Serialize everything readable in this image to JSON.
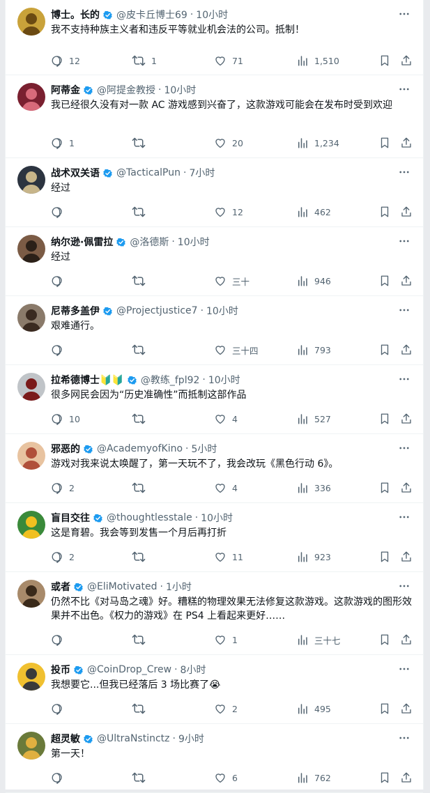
{
  "colors": {
    "verified": "#1d9bf0",
    "muted": "#536471",
    "text": "#0f1419"
  },
  "icons": {
    "reply": "reply-icon",
    "retweet": "retweet-icon",
    "like": "like-icon",
    "views": "views-icon",
    "bookmark": "bookmark-icon",
    "share": "share-icon",
    "more": "more-icon",
    "verified": "verified-badge-icon"
  },
  "tweets": [
    {
      "name": "博士。长的",
      "handle": "@皮卡丘博士69",
      "time": "10小时",
      "text": "我不支持种族主义者和违反平等就业机会法的公司。抵制！",
      "replies": "12",
      "retweets": "1",
      "likes": "71",
      "views": "1,510"
    },
    {
      "name": "阿蒂金",
      "handle": "@阿提金教授",
      "time": "10小时",
      "text": "我已经很久没有对一款 AC 游戏感到兴奋了，这款游戏可能会在发布时受到欢迎",
      "replies": "1",
      "retweets": "",
      "likes": "20",
      "views": "1,234"
    },
    {
      "name": "战术双关语",
      "handle": "@TacticalPun",
      "time": "7小时",
      "text": "经过",
      "replies": "",
      "retweets": "",
      "likes": "12",
      "views": "462"
    },
    {
      "name": "纳尔逊·佩雷拉",
      "handle": "@洛德斯",
      "time": "10小时",
      "text": "经过",
      "replies": "",
      "retweets": "",
      "likes": "三十",
      "views": "946"
    },
    {
      "name": "尼蒂多盖伊",
      "handle": "@Projectjustice7",
      "time": "10小时",
      "text": "艰难通行。",
      "replies": "",
      "retweets": "",
      "likes": "三十四",
      "views": "793"
    },
    {
      "name": "拉希德博士🔰🔰",
      "handle": "@教练_fpl92",
      "time": "10小时",
      "text": "很多网民会因为“历史准确性”而抵制这部作品",
      "replies": "10",
      "retweets": "",
      "likes": "4",
      "views": "527"
    },
    {
      "name": "邪恶的",
      "handle": "@AcademyofKino",
      "time": "5小时",
      "text": "游戏对我来说太唤醒了，第一天玩不了，我会改玩《黑色行动 6》。",
      "replies": "2",
      "retweets": "",
      "likes": "4",
      "views": "336"
    },
    {
      "name": "盲目交往",
      "handle": "@thoughtlesstale",
      "time": "10小时",
      "text": "这是育碧。我会等到发售一个月后再打折",
      "replies": "2",
      "retweets": "",
      "likes": "11",
      "views": "923"
    },
    {
      "name": "或者",
      "handle": "@EliMotivated",
      "time": "1小时",
      "text": "仍然不比《对马岛之魂》好。糟糕的物理效果无法修复这款游戏。这款游戏的图形效果并不出色。《权力的游戏》在 PS4 上看起来更好……",
      "replies": "",
      "retweets": "",
      "likes": "1",
      "views": "三十七"
    },
    {
      "name": "投币",
      "handle": "@CoinDrop_Crew",
      "time": "8小时",
      "text": "我想要它...但我已经落后 3 场比赛了😭",
      "replies": "",
      "retweets": "",
      "likes": "2",
      "views": "495"
    },
    {
      "name": "超灵敏",
      "handle": "@UltraNstinctz",
      "time": "9小时",
      "text": "第一天！",
      "replies": "",
      "retweets": "",
      "likes": "6",
      "views": "762"
    }
  ]
}
